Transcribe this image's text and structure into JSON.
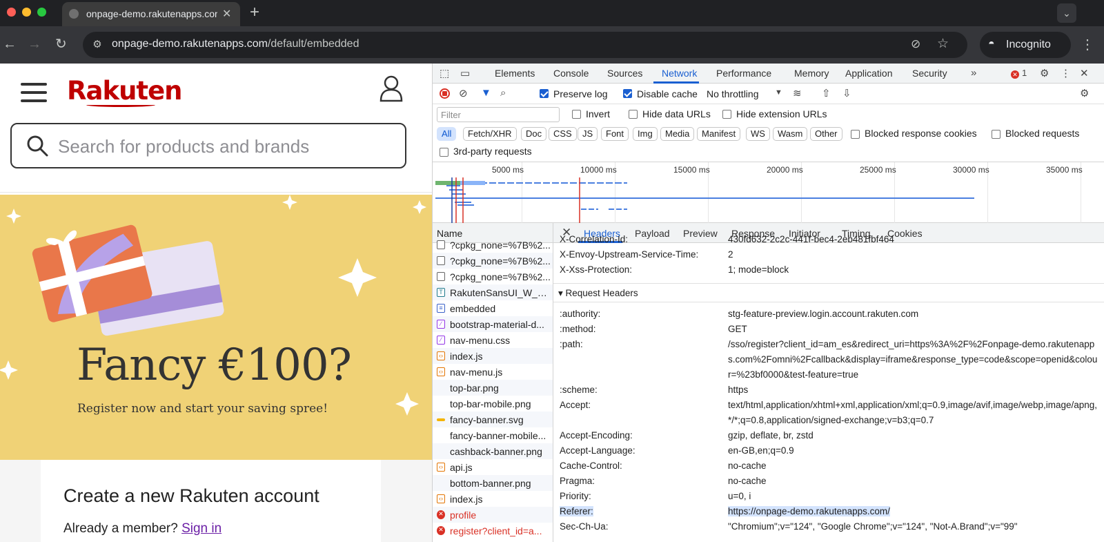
{
  "browser": {
    "tab_title": "onpage-demo.rakutenapps.com",
    "url_host": "onpage-demo.rakutenapps.com",
    "url_path": "/default/embedded",
    "incognito_label": "Incognito"
  },
  "page": {
    "logo": "Rakuten",
    "search_placeholder": "Search for products and brands",
    "banner_headline": "Fancy €100?",
    "banner_sub": "Register now and start your saving spree!",
    "create_heading": "Create a new Rakuten account",
    "already_member": "Already a member?",
    "sign_in": "Sign in"
  },
  "devtools": {
    "tabs": [
      "Elements",
      "Console",
      "Sources",
      "Network",
      "Performance",
      "Memory",
      "Application",
      "Security"
    ],
    "active_tab": "Network",
    "error_count": "1",
    "preserve_log": "Preserve log",
    "disable_cache": "Disable cache",
    "throttling": "No throttling",
    "filter_placeholder": "Filter",
    "invert": "Invert",
    "hide_data_urls": "Hide data URLs",
    "hide_extension_urls": "Hide extension URLs",
    "type_chips": [
      "All",
      "Fetch/XHR",
      "Doc",
      "CSS",
      "JS",
      "Font",
      "Img",
      "Media",
      "Manifest",
      "WS",
      "Wasm",
      "Other"
    ],
    "blocked_response_cookies": "Blocked response cookies",
    "blocked_requests": "Blocked requests",
    "third_party": "3rd-party requests",
    "timeline_ticks": [
      "5000 ms",
      "10000 ms",
      "15000 ms",
      "20000 ms",
      "25000 ms",
      "30000 ms",
      "35000 ms"
    ],
    "name_header": "Name",
    "requests": [
      {
        "name": "?cpkg_none=%7B%2...",
        "kind": "doc"
      },
      {
        "name": "?cpkg_none=%7B%2...",
        "kind": "doc"
      },
      {
        "name": "?cpkg_none=%7B%2...",
        "kind": "doc"
      },
      {
        "name": "RakutenSansUI_W_R...",
        "kind": "font"
      },
      {
        "name": "embedded",
        "kind": "html"
      },
      {
        "name": "bootstrap-material-d...",
        "kind": "css"
      },
      {
        "name": "nav-menu.css",
        "kind": "css"
      },
      {
        "name": "index.js",
        "kind": "js"
      },
      {
        "name": "nav-menu.js",
        "kind": "js"
      },
      {
        "name": "top-bar.png",
        "kind": "img"
      },
      {
        "name": "top-bar-mobile.png",
        "kind": "img"
      },
      {
        "name": "fancy-banner.svg",
        "kind": "svg"
      },
      {
        "name": "fancy-banner-mobile...",
        "kind": "img"
      },
      {
        "name": "cashback-banner.png",
        "kind": "img"
      },
      {
        "name": "api.js",
        "kind": "js"
      },
      {
        "name": "bottom-banner.png",
        "kind": "img"
      },
      {
        "name": "index.js",
        "kind": "js"
      },
      {
        "name": "profile",
        "kind": "error"
      },
      {
        "name": "register?client_id=a...",
        "kind": "error"
      }
    ],
    "detail_tabs": [
      "Headers",
      "Payload",
      "Preview",
      "Response",
      "Initiator",
      "Timing",
      "Cookies"
    ],
    "active_detail_tab": "Headers",
    "response_headers_tail": [
      {
        "key": "X-Correlation-Id:",
        "value": "430fd632-2c2c-441f-bec4-2eb481fbf464"
      },
      {
        "key": "X-Envoy-Upstream-Service-Time:",
        "value": "2"
      },
      {
        "key": "X-Xss-Protection:",
        "value": "1; mode=block"
      }
    ],
    "request_headers_title": "▾ Request Headers",
    "request_headers": [
      {
        "key": ":authority:",
        "value": "stg-feature-preview.login.account.rakuten.com"
      },
      {
        "key": ":method:",
        "value": "GET"
      },
      {
        "key": ":path:",
        "value": "/sso/register?client_id=am_es&redirect_uri=https%3A%2F%2Fonpage-demo.rakutenapps.com%2Fomni%2Fcallback&display=iframe&response_type=code&scope=openid&colour=%23bf0000&test-feature=true"
      },
      {
        "key": ":scheme:",
        "value": "https"
      },
      {
        "key": "Accept:",
        "value": "text/html,application/xhtml+xml,application/xml;q=0.9,image/avif,image/webp,image/apng,*/*;q=0.8,application/signed-exchange;v=b3;q=0.7"
      },
      {
        "key": "Accept-Encoding:",
        "value": "gzip, deflate, br, zstd"
      },
      {
        "key": "Accept-Language:",
        "value": "en-GB,en;q=0.9"
      },
      {
        "key": "Cache-Control:",
        "value": "no-cache"
      },
      {
        "key": "Pragma:",
        "value": "no-cache"
      },
      {
        "key": "Priority:",
        "value": "u=0, i"
      },
      {
        "key": "Referer:",
        "value": "https://onpage-demo.rakutenapps.com/"
      },
      {
        "key": "Sec-Ch-Ua:",
        "value": "\"Chromium\";v=\"124\", \"Google Chrome\";v=\"124\", \"Not-A.Brand\";v=\"99\""
      }
    ]
  }
}
